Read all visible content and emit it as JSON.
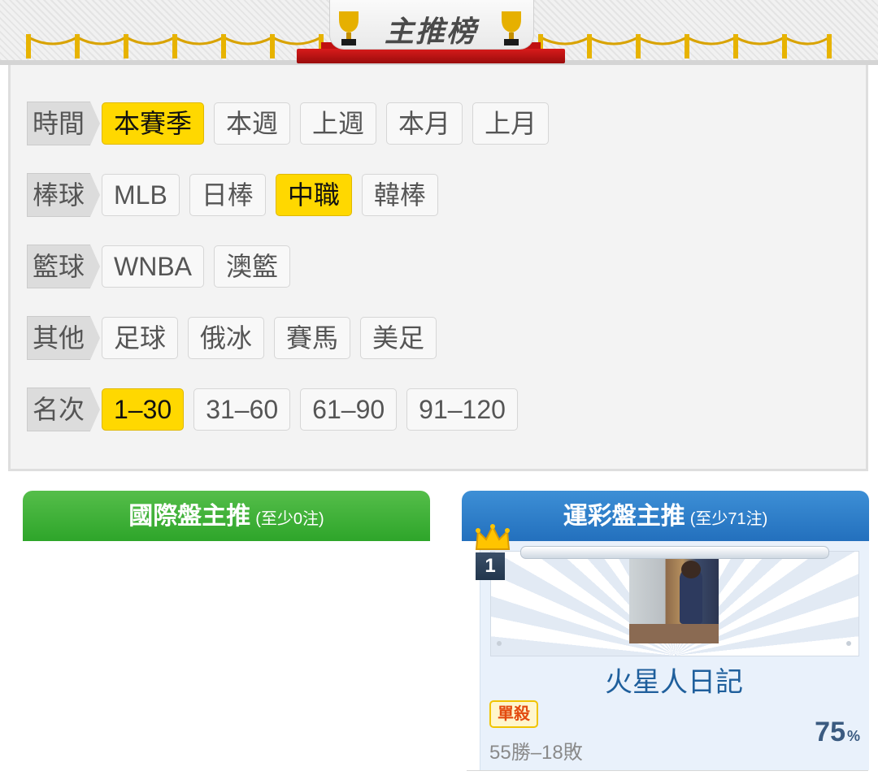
{
  "header": {
    "title": "主推榜"
  },
  "filters": [
    {
      "label": "時間",
      "options": [
        "本賽季",
        "本週",
        "上週",
        "本月",
        "上月"
      ],
      "selected": 0
    },
    {
      "label": "棒球",
      "options": [
        "MLB",
        "日棒",
        "中職",
        "韓棒"
      ],
      "selected": 2
    },
    {
      "label": "籃球",
      "options": [
        "WNBA",
        "澳籃"
      ],
      "selected": -1
    },
    {
      "label": "其他",
      "options": [
        "足球",
        "俄冰",
        "賽馬",
        "美足"
      ],
      "selected": -1
    },
    {
      "label": "名次",
      "options": [
        "1–30",
        "31–60",
        "61–90",
        "91–120"
      ],
      "selected": 0
    }
  ],
  "tabs": {
    "international": {
      "title": "國際盤主推",
      "subtitle": "(至少0注)"
    },
    "sportslottery": {
      "title": "運彩盤主推",
      "subtitle": "(至少71注)"
    }
  },
  "card": {
    "rank": "1",
    "name": "火星人日記",
    "badge": "單殺",
    "record": "55勝–18敗",
    "win_rate": "75",
    "win_rate_unit": "%"
  },
  "colors": {
    "active_chip": "#ffd800",
    "green_tab": "#2ea52a",
    "blue_tab": "#2370bd",
    "name_text": "#1f5f9c"
  }
}
